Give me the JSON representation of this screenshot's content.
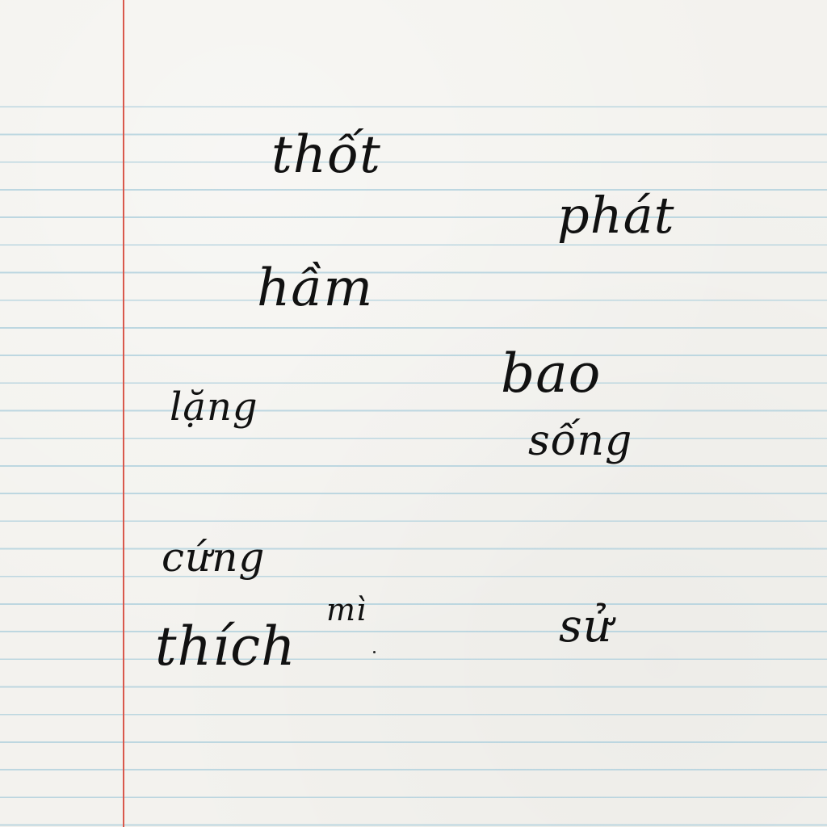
{
  "notebook": {
    "words": [
      "thốt",
      "phát",
      "hầm",
      "bao",
      "lặng",
      "sống",
      "cứng",
      "mì",
      "thích",
      "sử"
    ],
    "colors": {
      "paper": "#f3f2ee",
      "rule_line": "#b7d4df",
      "margin_line": "#d9584c",
      "ink": "#111111"
    }
  }
}
